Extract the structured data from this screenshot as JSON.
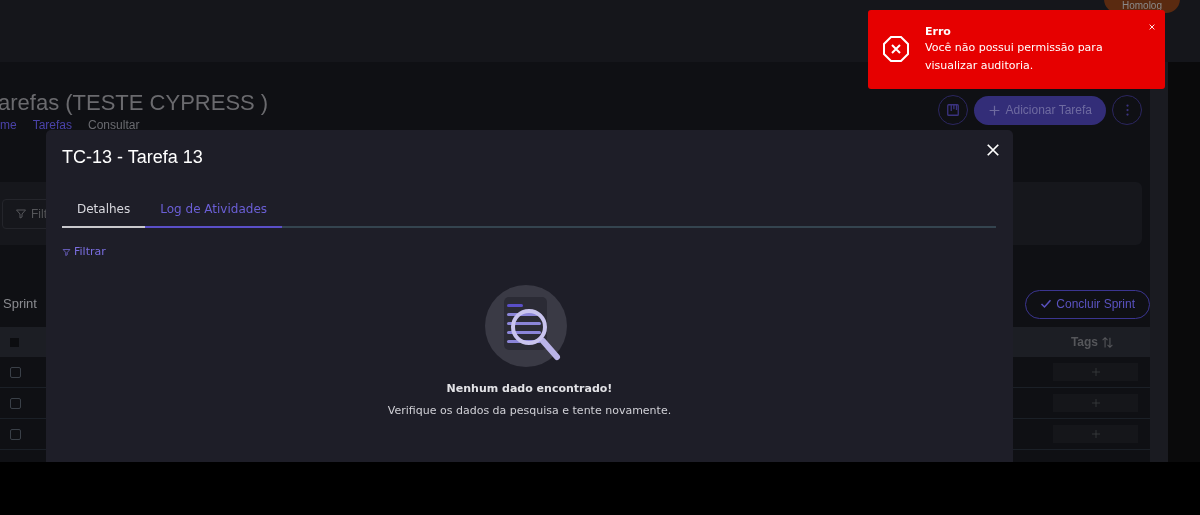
{
  "header": {
    "badge": "Homolog"
  },
  "page": {
    "title": "arefas (TESTE CYPRESS )",
    "breadcrumb": [
      {
        "label": "me",
        "kind": "link"
      },
      {
        "label": "Tarefas",
        "kind": "link"
      },
      {
        "label": "Consultar",
        "kind": "current"
      }
    ],
    "add_button": "Adicionar Tarefa",
    "filter_button": "Filt",
    "sprint_label": "Sprint",
    "conclude_button": "Concluir Sprint",
    "table": {
      "header_checkbox": {
        "checked": false
      },
      "columns": [
        {
          "label": "Tags"
        }
      ],
      "rows": [
        {
          "checked": false
        },
        {
          "checked": false
        },
        {
          "checked": false
        }
      ]
    }
  },
  "modal": {
    "title": "TC-13 - Tarefa 13",
    "tabs": [
      {
        "label": "Detalhes",
        "selected": false
      },
      {
        "label": "Log de Atividades",
        "selected": true
      }
    ],
    "filter_link": "Filtrar",
    "empty": {
      "title": "Nenhum dado encontrado!",
      "message": "Verifique os dados da pesquisa e tente novamente."
    }
  },
  "toast": {
    "title": "Erro",
    "message": "Você não possui permissão para visualizar auditoria."
  }
}
